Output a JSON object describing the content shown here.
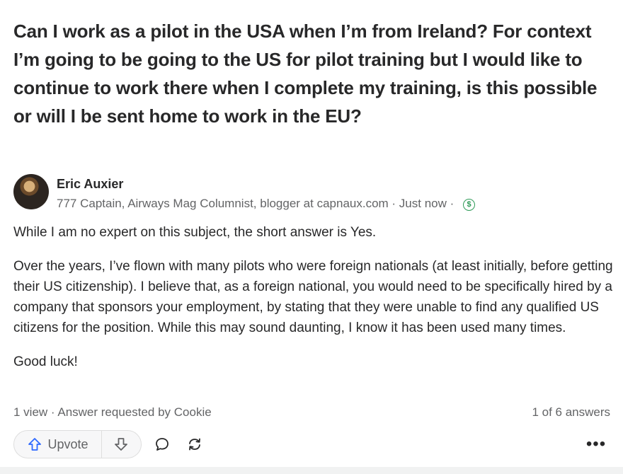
{
  "question": {
    "title": "Can I work as a pilot in the USA when I’m from Ireland? For context I’m going to be going to the US for pilot training but I would like to continue to work there when I complete my training, is this possible or will I be sent home to work in the EU?"
  },
  "author": {
    "name": "Eric Auxier",
    "credentials": "777 Captain, Airways Mag Columnist, blogger at capnaux.com · Just now ·",
    "badge_icon": "dollar-icon"
  },
  "answer": {
    "paragraphs": [
      "While I am no expert on this subject, the short answer is Yes.",
      "Over the years, I’ve flown with many pilots who were foreign nationals (at least initially, before getting their US citizenship). I believe that, as a foreign national, you would need to be specifically hired by a company that sponsors your employment, by stating that they were unable to find any qualified US citizens for the position. While this may sound daunting, I know it has been used many times.",
      "Good luck!"
    ]
  },
  "footer": {
    "stats": "1 view · Answer requested by Cookie",
    "answer_count": "1 of 6 answers"
  },
  "actions": {
    "upvote_label": "Upvote",
    "icons": [
      "upvote-arrow-icon",
      "downvote-arrow-icon",
      "comment-icon",
      "share-icon",
      "more-icon"
    ],
    "more_glyph": "•••"
  },
  "colors": {
    "text_primary": "#282829",
    "text_secondary": "#636466",
    "button_border": "#dedede",
    "button_background": "#f7f7f8",
    "badge_green": "#2e9a57",
    "vote_icon_blue": "#2e69ff"
  }
}
